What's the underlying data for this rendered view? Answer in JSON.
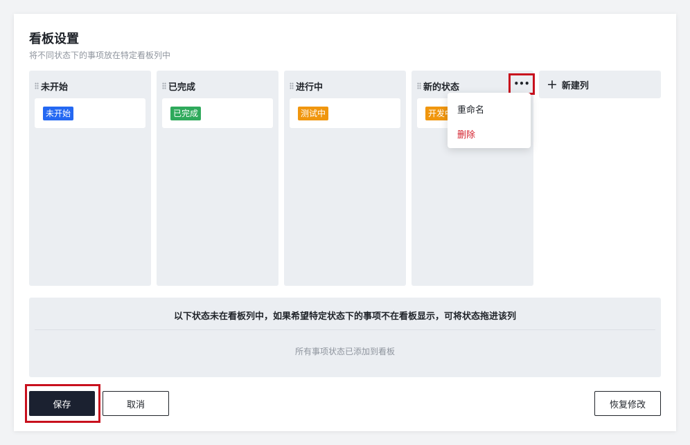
{
  "header": {
    "title": "看板设置",
    "subtitle": "将不同状态下的事项放在特定看板列中"
  },
  "columns": [
    {
      "title": "未开始",
      "card_tag": "未开始",
      "tag_color": "#2468f2"
    },
    {
      "title": "已完成",
      "card_tag": "已完成",
      "tag_color": "#2ea95b"
    },
    {
      "title": "进行中",
      "card_tag": "测试中",
      "tag_color": "#f0960e"
    },
    {
      "title": "新的状态",
      "card_tag": "开发中",
      "tag_color": "#f0960e"
    }
  ],
  "column_menu": {
    "more_icon": "more-horizontal-icon",
    "items": [
      {
        "label": "重命名",
        "color": "#1f2329"
      },
      {
        "label": "删除",
        "color": "#d3212d"
      }
    ]
  },
  "new_column": {
    "icon": "plus-icon",
    "label": "新建列"
  },
  "unassigned": {
    "title": "以下状态未在看板列中，如果希望特定状态下的事项不在看板显示，可将状态拖进该列",
    "empty_text": "所有事项状态已添加到看板"
  },
  "footer": {
    "save_label": "保存",
    "cancel_label": "取消",
    "restore_label": "恢复修改"
  },
  "colors": {
    "highlight": "#c8101d",
    "primary_button": "#1b2130",
    "column_bg": "#ebeef2"
  }
}
